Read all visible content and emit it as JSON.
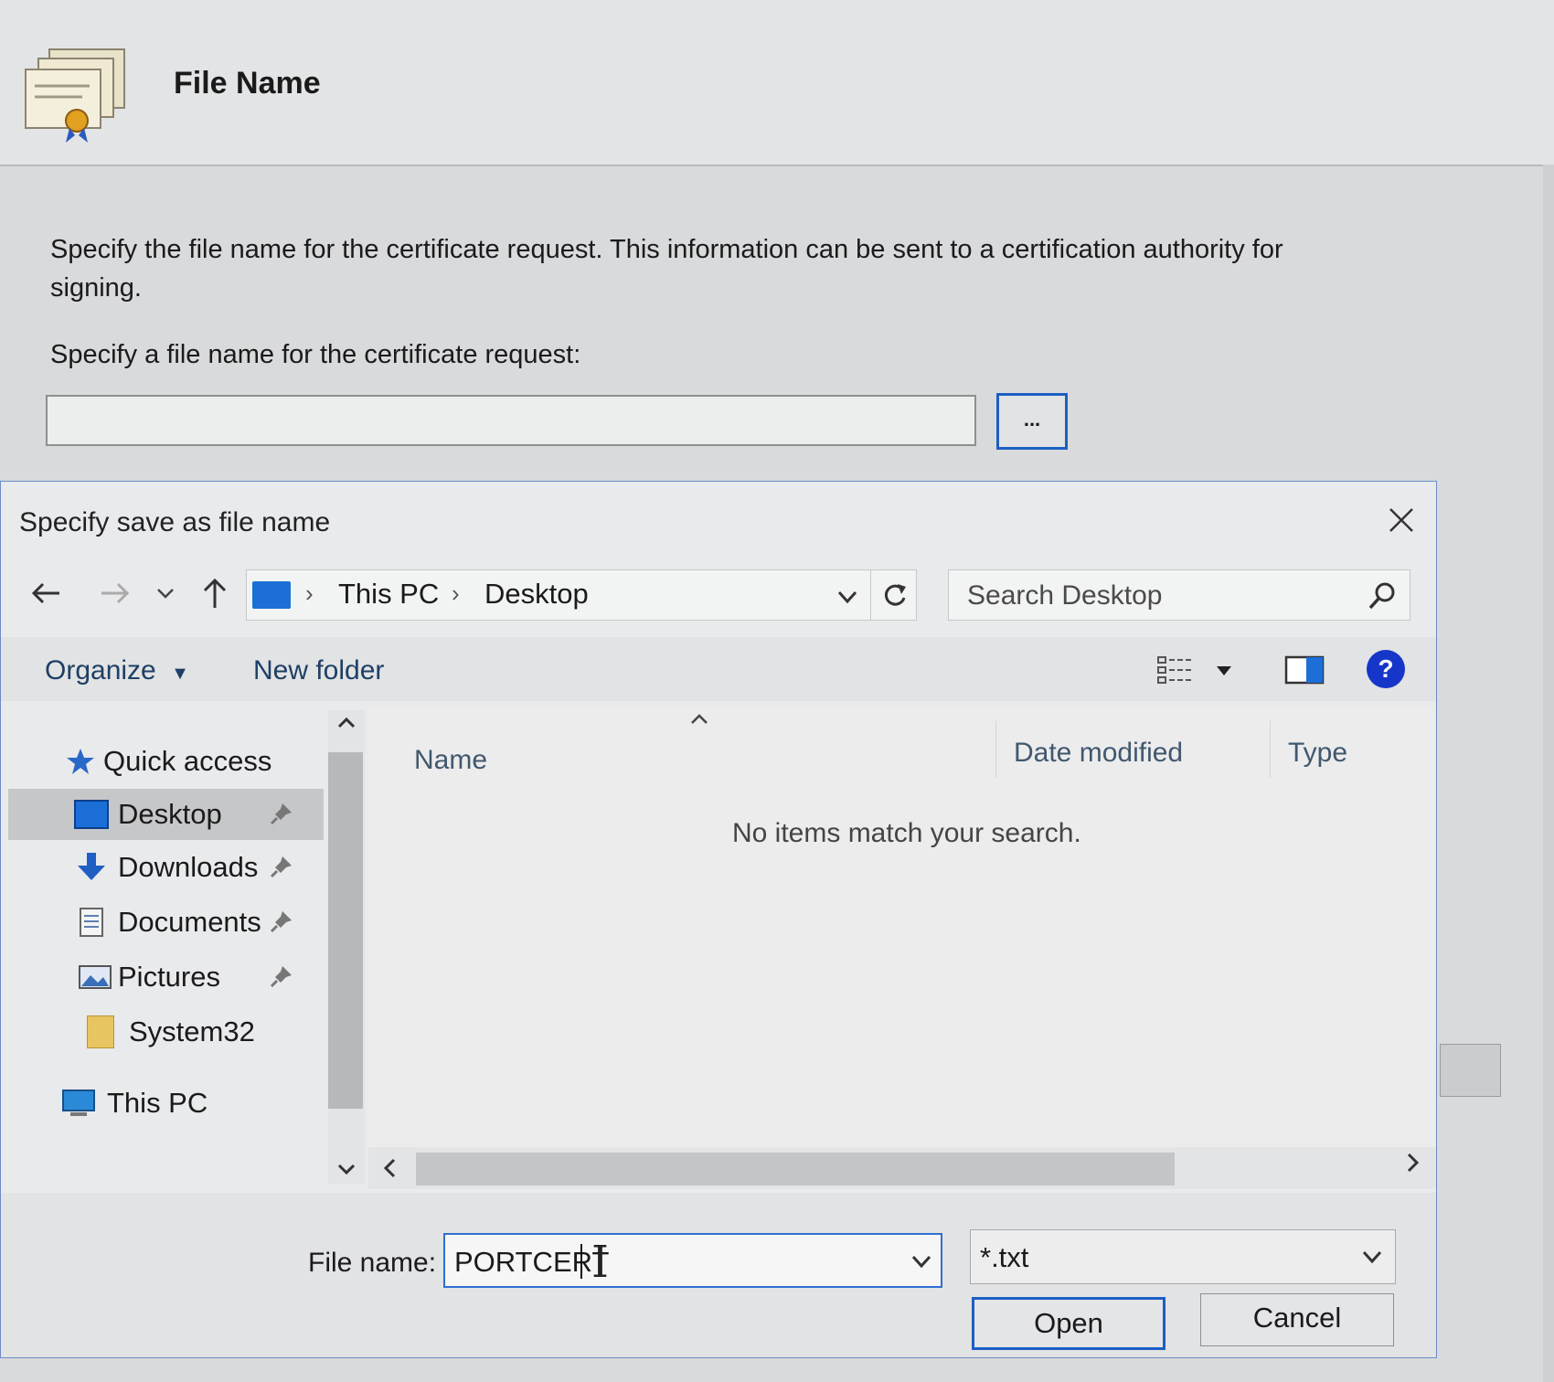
{
  "wizard": {
    "title": "File Name",
    "description": "Specify the file name for the certificate request. This information can be sent to a certification authority for signing.",
    "field_label": "Specify a file name for the certificate request:",
    "filename_value": "",
    "browse_label": "..."
  },
  "dialog": {
    "title": "Specify save as file name",
    "address": {
      "crumbs": [
        "This PC",
        "Desktop"
      ]
    },
    "search_placeholder": "Search Desktop",
    "toolbar": {
      "organize": "Organize",
      "new_folder": "New folder",
      "help": "?"
    },
    "nav": {
      "quick_access": "Quick access",
      "items": [
        {
          "label": "Desktop",
          "icon": "desktop-icon",
          "pinned": true,
          "selected": true
        },
        {
          "label": "Downloads",
          "icon": "downloads-icon",
          "pinned": true
        },
        {
          "label": "Documents",
          "icon": "documents-icon",
          "pinned": true
        },
        {
          "label": "Pictures",
          "icon": "pictures-icon",
          "pinned": true
        },
        {
          "label": "System32",
          "icon": "folder-icon",
          "pinned": false
        }
      ],
      "this_pc": "This PC"
    },
    "columns": [
      "Name",
      "Date modified",
      "Type"
    ],
    "empty_message": "No items match your search.",
    "file_name_label": "File name:",
    "file_name_value": "PORTCERT",
    "file_type_value": "*.txt",
    "open_label": "Open",
    "cancel_label": "Cancel"
  },
  "colors": {
    "accent": "#1c5fc4",
    "help": "#1536c9",
    "folder_icon": "#1d6fd8"
  }
}
